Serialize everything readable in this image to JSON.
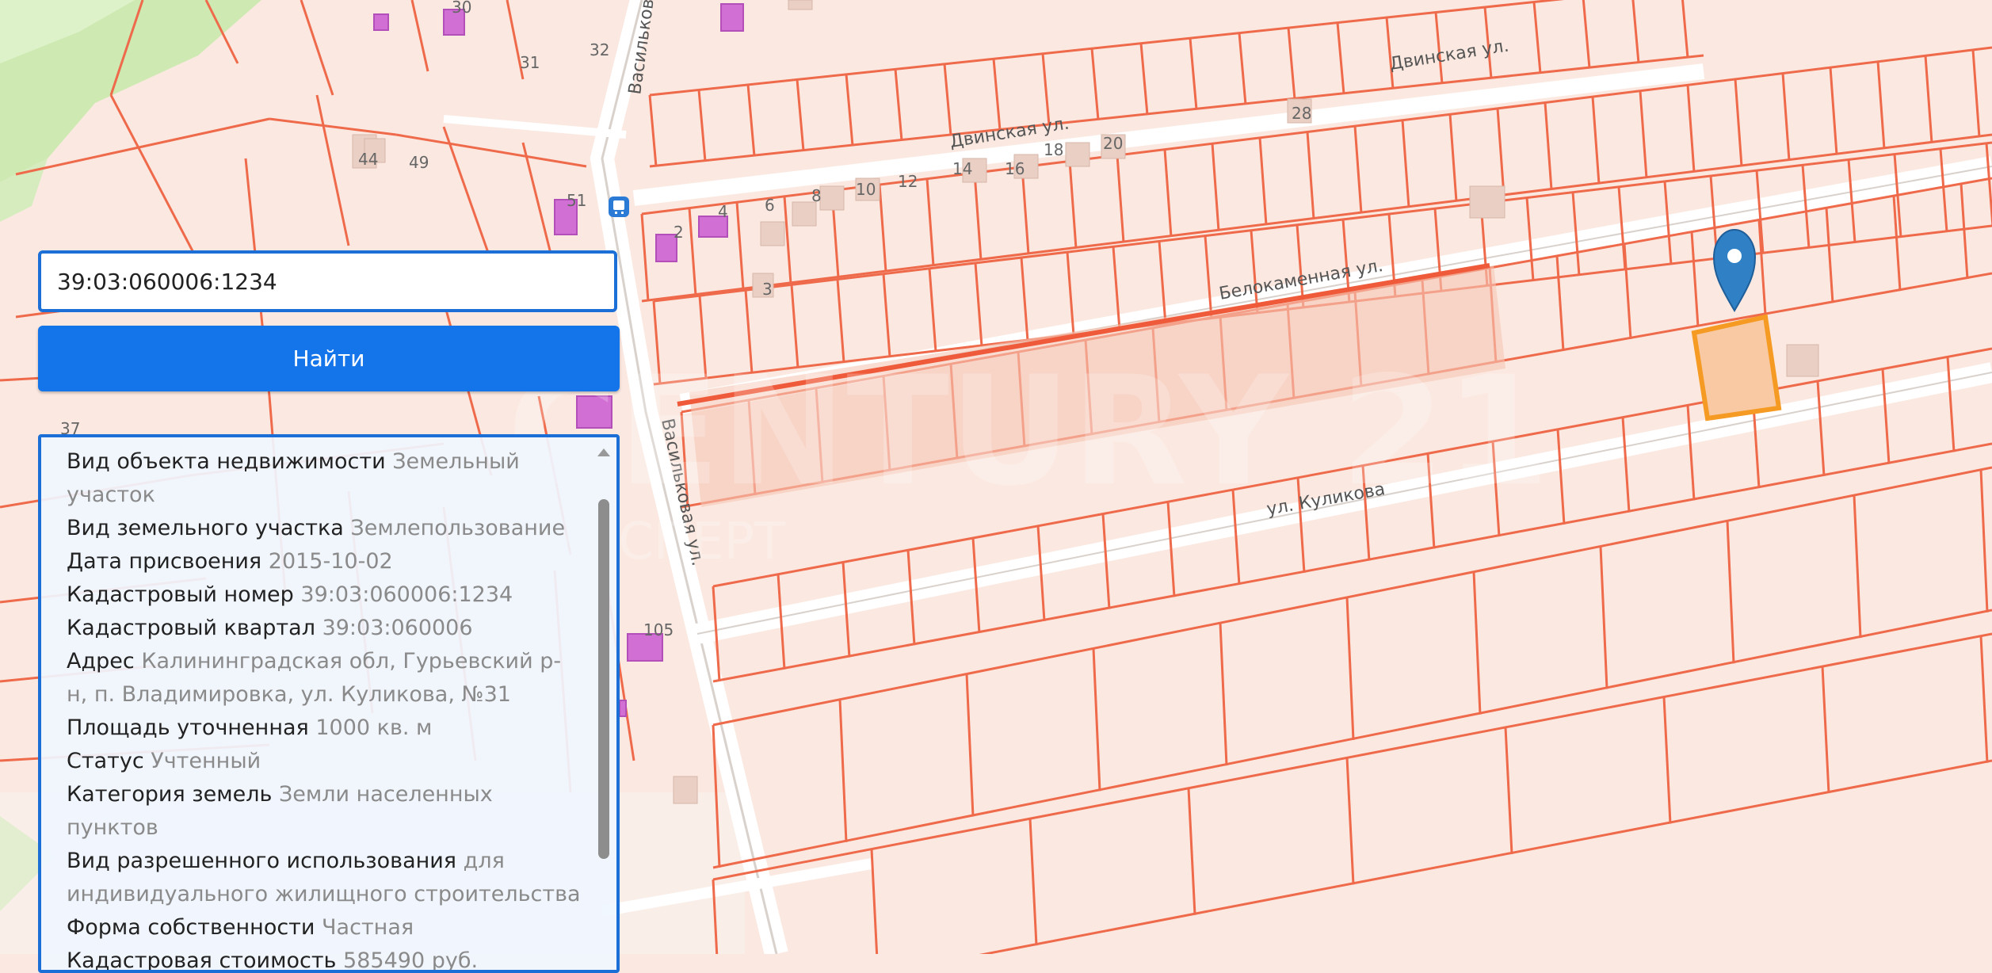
{
  "search": {
    "value": "39:03:060006:1234"
  },
  "find_button": {
    "label": "Найти"
  },
  "info": {
    "items": [
      {
        "key": "Вид объекта недвижимости",
        "value": "Земельный участок"
      },
      {
        "key": "Вид земельного участка",
        "value": "Землепользование"
      },
      {
        "key": "Дата присвоения",
        "value": "2015-10-02"
      },
      {
        "key": "Кадастровый номер",
        "value": "39:03:060006:1234"
      },
      {
        "key": "Кадастровый квартал",
        "value": "39:03:060006"
      },
      {
        "key": "Адрес",
        "value": "Калининградская обл, Гурьевский р-н, п. Владимировка, ул. Куликова, №31"
      },
      {
        "key": "Площадь уточненная",
        "value": "1000 кв. м"
      },
      {
        "key": "Статус",
        "value": "Учтенный"
      },
      {
        "key": "Категория земель",
        "value": "Земли населенных пунктов"
      },
      {
        "key": "Вид разрешенного использования",
        "value": "для индивидуального жилищного строительства"
      },
      {
        "key": "Форма собственности",
        "value": "Частная"
      },
      {
        "key": "Кадастровая стоимость",
        "value": "585490 руб."
      }
    ]
  },
  "map": {
    "streets": {
      "dvinskaya_right": "Двинская ул.",
      "dvinskaya_left": "Двинская ул.",
      "belokamennaya": "Белокаменная ул.",
      "kulikova": "ул. Куликова",
      "vasilkovaya_top": "Васильковая ул.",
      "vasilkovaya_mid": "Васильковая ул."
    },
    "house_numbers": {
      "n30": "30",
      "n31": "31",
      "n32": "32",
      "n44": "44",
      "n49": "49",
      "n51": "51",
      "n2": "2",
      "n3": "3",
      "n4": "4",
      "n6": "6",
      "n8": "8",
      "n10": "10",
      "n12": "12",
      "n14": "14",
      "n16": "16",
      "n18": "18",
      "n20": "20",
      "n28": "28",
      "n37": "37",
      "n105": "105"
    },
    "watermark": "CENTURY 21",
    "watermark_sub": "ЭКСПЕРТ",
    "colors": {
      "parcel_fill": "#fbe9e1",
      "parcel_line": "#ee6a4b",
      "selected_outline": "#f59a23",
      "marker": "#2f80c4",
      "building_pink": "#d26fd4",
      "forest_green": "#cfe9b3"
    }
  }
}
